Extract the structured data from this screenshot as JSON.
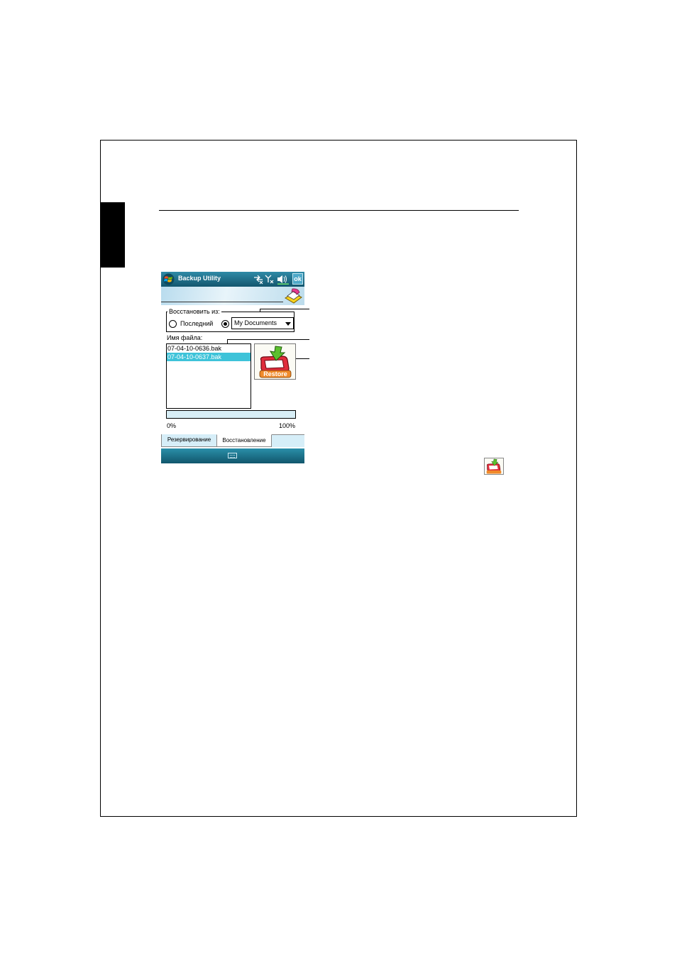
{
  "app": {
    "title": "Backup Utility",
    "ok_label": "ok"
  },
  "restore_from": {
    "legend": "Восстановить из:",
    "option_last_label": "Последний",
    "option_last_selected": false,
    "option_folder_selected": true,
    "folder_value": "My Documents"
  },
  "files": {
    "label": "Имя файла:",
    "items": [
      {
        "name": "07-04-10-0636.bak",
        "selected": false
      },
      {
        "name": "07-04-10-0637.bak",
        "selected": true
      }
    ]
  },
  "restore_button": {
    "icon": "restore-icon",
    "icon_text": "Restore"
  },
  "progress": {
    "value": 0,
    "min_label": "0%",
    "max_label": "100%"
  },
  "tabs": [
    {
      "label": "Резервирование",
      "active": false
    },
    {
      "label": "Восстановление",
      "active": true
    }
  ],
  "icons": {
    "start": "windows-start-icon",
    "connectivity": "connectivity-off-icon",
    "signal": "signal-off-icon",
    "volume": "volume-icon",
    "keyboard": "keyboard-icon"
  },
  "colors": {
    "titlebar": "#1f7690",
    "selection": "#3ec3d9",
    "tabbar": "#d6eef8"
  }
}
